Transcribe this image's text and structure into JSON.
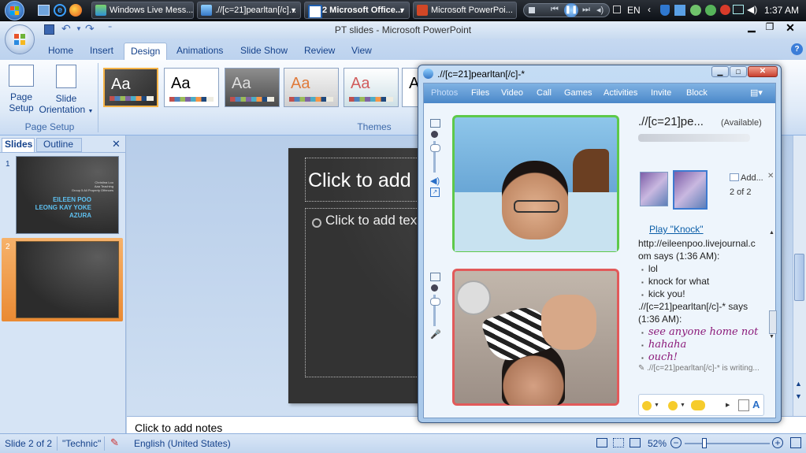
{
  "taskbar": {
    "items": [
      {
        "label": "Windows Live Mess..."
      },
      {
        "label": ".//[c=21]pearltan[/c]..."
      },
      {
        "label": "2 Microsoft Office..."
      },
      {
        "label": "Microsoft PowerPoi..."
      }
    ],
    "language": "EN",
    "clock": "1:37 AM"
  },
  "ppt": {
    "title": "PT slides - Microsoft PowerPoint",
    "tabs": [
      "Home",
      "Insert",
      "Design",
      "Animations",
      "Slide Show",
      "Review",
      "View"
    ],
    "active_tab": "Design",
    "page_setup": {
      "page_setup_label_1": "Page",
      "page_setup_label_2": "Setup",
      "orientation_label_1": "Slide",
      "orientation_label_2": "Orientation",
      "group_label": "Page Setup"
    },
    "themes_group_label": "Themes",
    "theme_sample": "Aa",
    "pane_tabs": {
      "slides": "Slides",
      "outline": "Outline"
    },
    "thumbnails": [
      {
        "number": "1",
        "small_lines": [
          "Christina Loo",
          "Aaa Teaching",
          "Group 5 All Property Offences"
        ],
        "names": [
          "EILEEN POO",
          "LEONG KAY YOKE",
          "AZURA"
        ]
      },
      {
        "number": "2"
      }
    ],
    "slide": {
      "title_placeholder": "Click to add",
      "body_placeholder": "Click to add tex"
    },
    "notes_placeholder": "Click to add notes",
    "status": {
      "slide": "Slide 2 of 2",
      "theme": "\"Technic\"",
      "language": "English (United States)",
      "zoom": "52%"
    }
  },
  "messenger": {
    "title": ".//[c=21]pearltan[/c]-*",
    "menu": [
      "Photos",
      "Files",
      "Video",
      "Call",
      "Games",
      "Activities",
      "Invite",
      "Block"
    ],
    "contact_name": ".//[c=21]pe...",
    "contact_status": "(Available)",
    "add_label": "Add...",
    "page_counter": "2 of 2",
    "play_link": "Play \"Knock\"",
    "messages": [
      {
        "text": "http://eileenpoo.livejournal.c",
        "style": "header"
      },
      {
        "text": "om says (1:36 AM):",
        "style": "header"
      },
      {
        "text": "lol",
        "style": "bullet"
      },
      {
        "text": "knock for what",
        "style": "bullet"
      },
      {
        "text": "kick you!",
        "style": "bullet"
      },
      {
        "text": ".//[c=21]pearltan[/c]-* says",
        "style": "header"
      },
      {
        "text": "(1:36 AM):",
        "style": "header"
      },
      {
        "text": "see anyone home not",
        "style": "bullet-italic"
      },
      {
        "text": "hahaha",
        "style": "bullet-italic"
      },
      {
        "text": "ouch!",
        "style": "bullet-italic"
      }
    ],
    "typing": ".//[c=21]pearltan[/c]-* is writing..."
  },
  "colors": {
    "ppt_accent": "#15428b",
    "italic_message": "#8b1a7a",
    "link": "#0b5ea8",
    "cam_top_border": "#5ec94a",
    "cam_bottom_border": "#e25a5a"
  }
}
